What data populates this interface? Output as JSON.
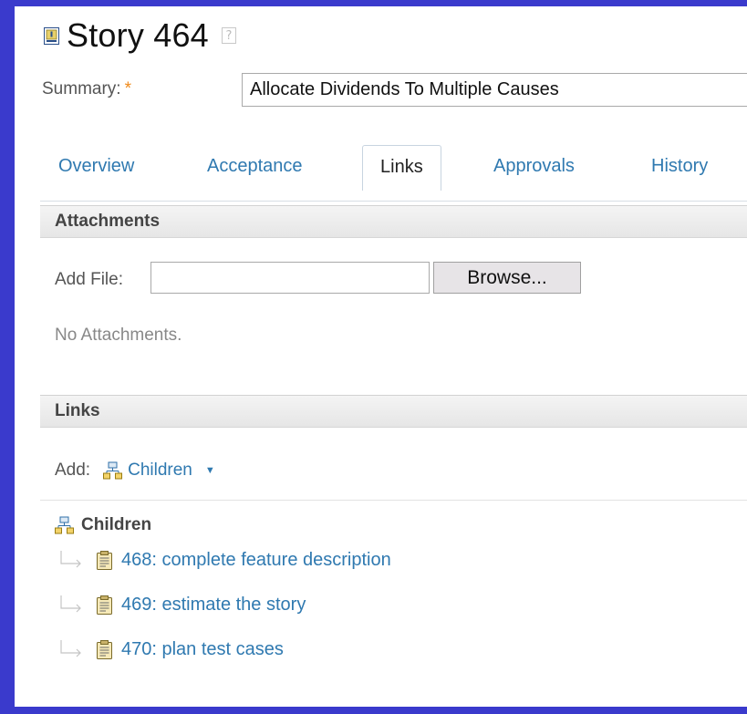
{
  "header": {
    "title": "Story 464",
    "help_glyph": "?"
  },
  "summary": {
    "label": "Summary:",
    "required_marker": "*",
    "value": "Allocate Dividends To Multiple Causes"
  },
  "tabs": [
    {
      "label": "Overview",
      "active": false
    },
    {
      "label": "Acceptance",
      "active": false
    },
    {
      "label": "Links",
      "active": true
    },
    {
      "label": "Approvals",
      "active": false
    },
    {
      "label": "History",
      "active": false
    }
  ],
  "attachments": {
    "section_title": "Attachments",
    "add_file_label": "Add File:",
    "file_value": "",
    "browse_label": "Browse...",
    "empty_message": "No Attachments."
  },
  "links": {
    "section_title": "Links",
    "add_label": "Add:",
    "add_menu_label": "Children",
    "group_title": "Children",
    "children": [
      {
        "label": "468: complete feature description"
      },
      {
        "label": "469: estimate the story"
      },
      {
        "label": "470: plan test cases"
      }
    ]
  },
  "colors": {
    "frame_border": "#3a3acc",
    "link": "#2f79b0",
    "required": "#f08a1a"
  },
  "icons": {
    "story": "story-icon",
    "help": "help-icon",
    "children": "hierarchy-icon",
    "child_item": "task-clipboard-icon",
    "connector": "tree-connector-icon",
    "caret": "chevron-down-icon"
  }
}
